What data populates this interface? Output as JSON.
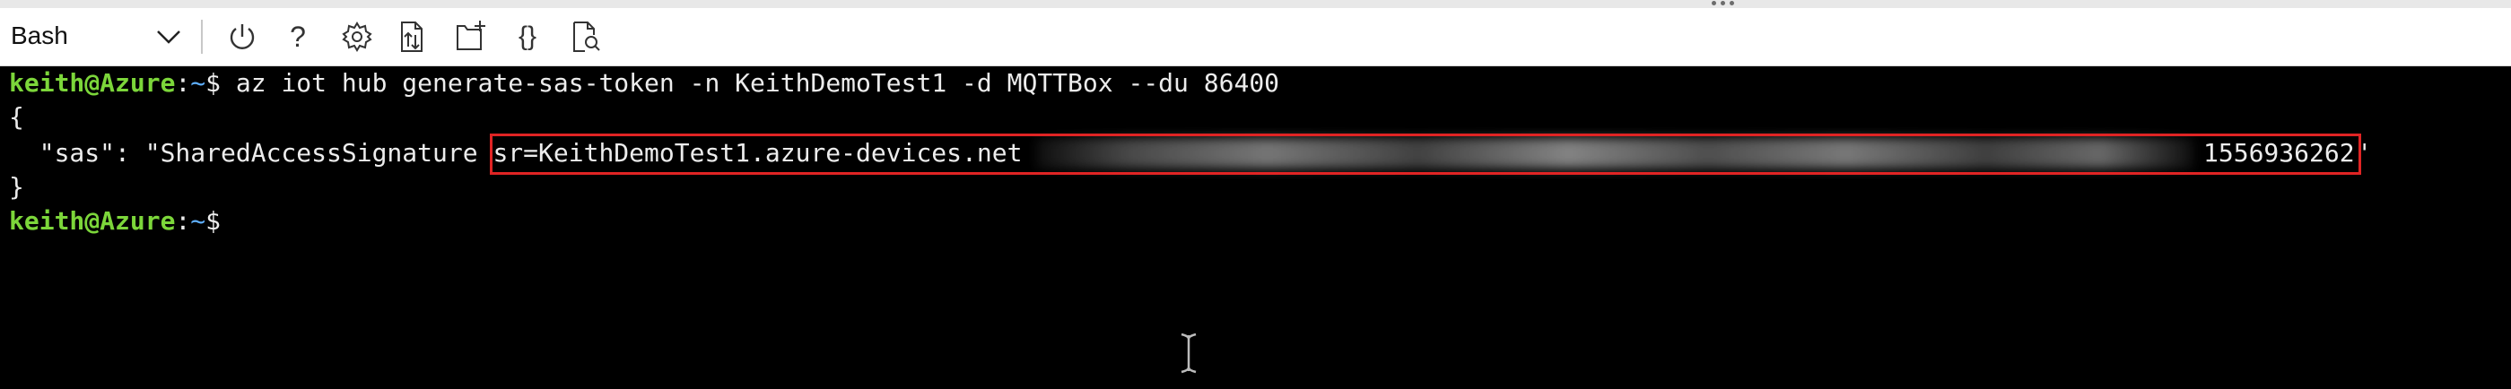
{
  "toolbar": {
    "shell_selected": "Bash",
    "buttons": [
      {
        "name": "restart",
        "icon": "power-icon"
      },
      {
        "name": "help",
        "icon": "question-icon",
        "glyph": "?"
      },
      {
        "name": "settings",
        "icon": "gear-icon"
      },
      {
        "name": "upload-download",
        "icon": "file-transfer-icon"
      },
      {
        "name": "new-session",
        "icon": "new-session-icon"
      },
      {
        "name": "editor",
        "icon": "braces-icon",
        "glyph": "{}"
      },
      {
        "name": "web-preview",
        "icon": "web-preview-icon"
      }
    ]
  },
  "terminal": {
    "prompt_user": "keith@Azure",
    "prompt_sep": ":",
    "prompt_path": "~",
    "prompt_symbol": "$ ",
    "command": "az iot hub generate-sas-token -n KeithDemoTest1 -d MQTTBox --du 86400",
    "open_brace": "{",
    "sas_key": "  \"sas\": \"SharedAccessSignature ",
    "sas_resource": "sr=KeithDemoTest1.azure-devices.net",
    "sas_expiry": "1556936262",
    "sas_close_quote": "\"",
    "close_brace": "}"
  },
  "colors": {
    "terminal_bg": "#000000",
    "user_green": "#7cd63a",
    "path_blue": "#5fb0ff",
    "highlight_red": "#e02424"
  }
}
